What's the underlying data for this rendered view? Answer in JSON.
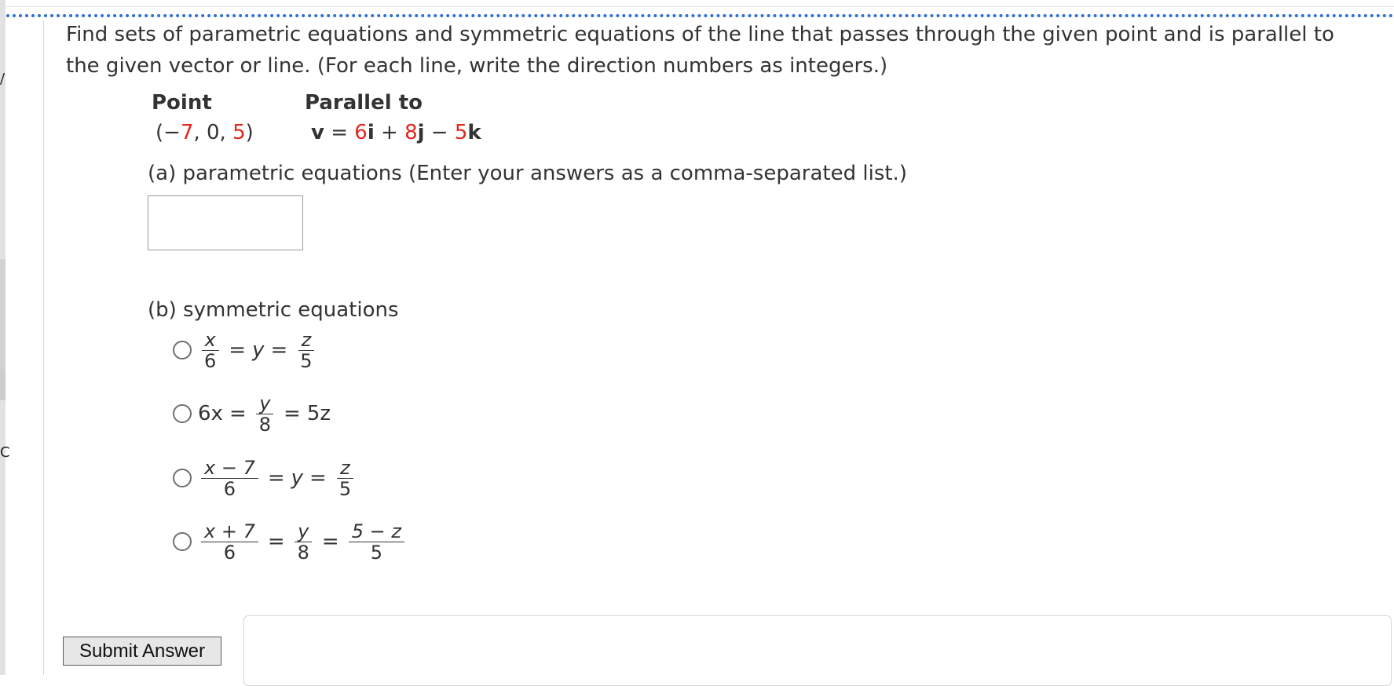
{
  "margin_marks": [
    "/",
    "C"
  ],
  "question": {
    "text": "Find sets of parametric equations and symmetric equations of the line that passes through the given point and is parallel to the given vector or line. (For each line, write the direction numbers as integers.)"
  },
  "table": {
    "point_header": "Point",
    "parallel_header": "Parallel to",
    "point": {
      "open": "(−",
      "x": "7",
      "sep1": ", 0, ",
      "z": "5",
      "close": ")"
    },
    "vector": {
      "v": "v",
      "eq": " = ",
      "c1": "6",
      "i": "i",
      "plus": " + ",
      "c2": "8",
      "j": "j",
      "minus": " − ",
      "c3": "5",
      "k": "k"
    }
  },
  "part_a": {
    "label": "(a) parametric equations (Enter your answers as a comma-separated list.)",
    "input_value": "",
    "input_placeholder": ""
  },
  "part_b": {
    "label": "(b) symmetric equations",
    "options": [
      {
        "f1_num": "x",
        "f1_den": "6",
        "eq1": "=",
        "mid": "y",
        "eq2": "=",
        "f2_num": "z",
        "f2_den": "5"
      },
      {
        "lead": "6x",
        "eq1": "=",
        "f_num": "y",
        "f_den": "8",
        "eq2": "=",
        "tail": "5z"
      },
      {
        "f1_num": "x − 7",
        "f1_den": "6",
        "eq1": "=",
        "mid": "y",
        "eq2": "=",
        "f2_num": "z",
        "f2_den": "5"
      },
      {
        "f1_num": "x + 7",
        "f1_den": "6",
        "eq1": "=",
        "f2_num": "y",
        "f2_den": "8",
        "eq2": "=",
        "f3_num": "5 − z",
        "f3_den": "5"
      }
    ]
  },
  "submit": {
    "label": "Submit Answer"
  },
  "colors": {
    "accent_dotted": "#2f6fd6",
    "highlight_red": "#e0261d",
    "text": "#333333"
  }
}
